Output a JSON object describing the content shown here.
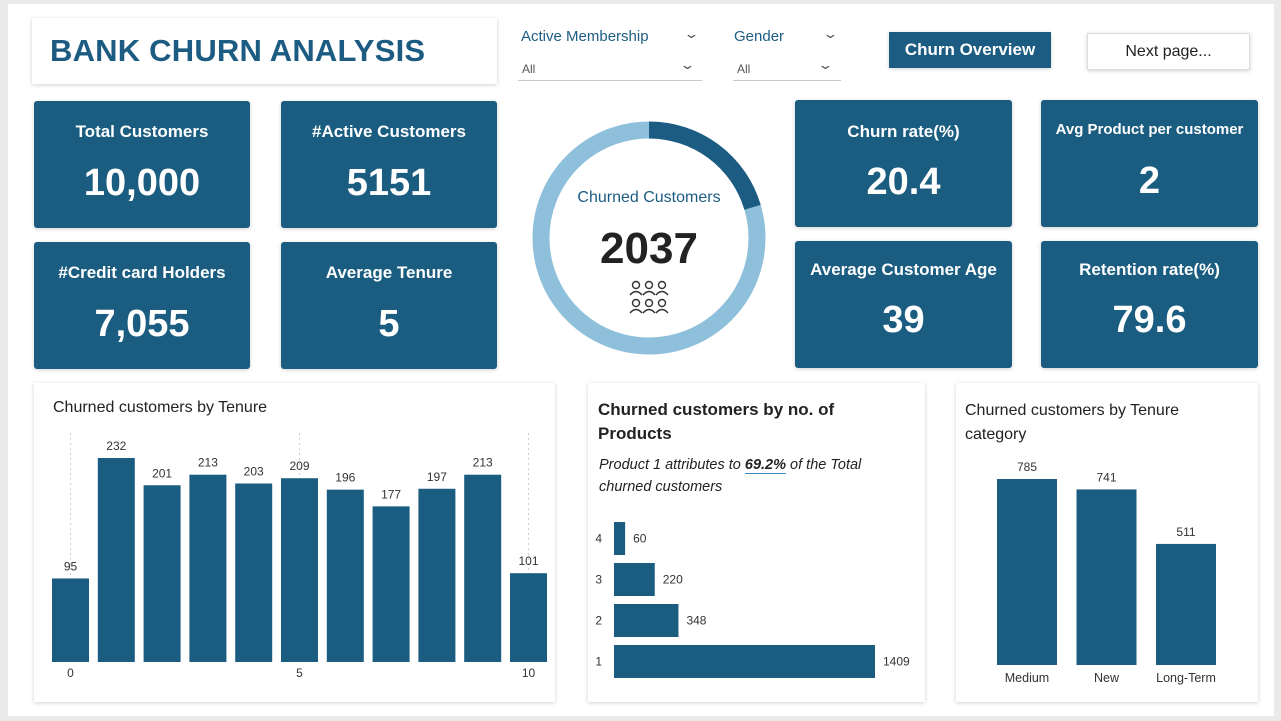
{
  "header": {
    "title": "BANK CHURN ANALYSIS",
    "filters": [
      {
        "label": "Active Membership",
        "value": "All"
      },
      {
        "label": "Gender",
        "value": "All"
      }
    ],
    "buttons": {
      "overview": "Churn Overview",
      "next": "Next page..."
    }
  },
  "kpis": {
    "total_customers": {
      "label": "Total Customers",
      "value": "10,000"
    },
    "active_customers": {
      "label": "#Active Customers",
      "value": "5151"
    },
    "credit_card_holders": {
      "label": "#Credit card Holders",
      "value": "7,055"
    },
    "average_tenure": {
      "label": "Average Tenure",
      "value": "5"
    },
    "churn_rate": {
      "label": "Churn rate(%)",
      "value": "20.4"
    },
    "avg_product": {
      "label": "Avg Product per customer",
      "value": "2"
    },
    "avg_age": {
      "label": "Average Customer Age",
      "value": "39"
    },
    "retention_rate": {
      "label": "Retention rate(%)",
      "value": "79.6"
    }
  },
  "donut": {
    "label": "Churned Customers",
    "value": "2037",
    "churned_fraction": 0.204,
    "colors": {
      "churned": "#1c5c82",
      "retained": "#8fc0db"
    },
    "icon": "people-group-icon"
  },
  "chart_data": [
    {
      "type": "bar",
      "title": "Churned customers by Tenure",
      "categories": [
        "0",
        "1",
        "2",
        "3",
        "4",
        "5",
        "6",
        "7",
        "8",
        "9",
        "10"
      ],
      "tick_labels": {
        "0": "0",
        "5": "5",
        "10": "10"
      },
      "values": [
        95,
        232,
        201,
        213,
        203,
        209,
        196,
        177,
        197,
        213,
        101
      ],
      "ylim": [
        0,
        232
      ],
      "color": "#1a5d80"
    },
    {
      "type": "bar",
      "orientation": "horizontal",
      "title": "Churned customers by no. of Products",
      "subtitle_parts": [
        "Product 1 attributes to ",
        "69.2%",
        " of the Total churned customers"
      ],
      "categories": [
        "4",
        "3",
        "2",
        "1"
      ],
      "values": [
        60,
        220,
        348,
        1409
      ],
      "color": "#1a5d80"
    },
    {
      "type": "bar",
      "title": "Churned customers by Tenure category",
      "categories": [
        "Medium",
        "New",
        "Long-Term"
      ],
      "values": [
        785,
        741,
        511
      ],
      "color": "#1a5d80"
    }
  ]
}
